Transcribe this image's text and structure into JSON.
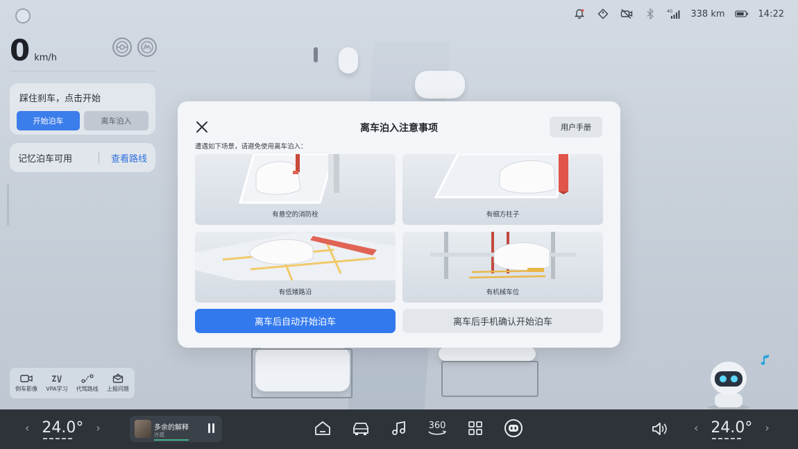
{
  "status_bar": {
    "range": "338 km",
    "time": "14:22",
    "icons": [
      "bell-icon",
      "tag-icon",
      "camera-off-icon",
      "bluetooth-icon",
      "signal-4g-icon",
      "battery-icon"
    ]
  },
  "left_panel": {
    "speed": "0",
    "speed_unit": "km/h",
    "assist_icons": [
      "apa-icon",
      "vpa-icon"
    ],
    "hint_text": "踩住刹车，点击开始",
    "start_parking_label": "开始泊车",
    "remote_parking_label": "离车泊入",
    "memory_parking_label": "记忆泊车可用",
    "view_route_label": "查看路线"
  },
  "tools": [
    {
      "label": "倒车影像",
      "icon": "camera-icon"
    },
    {
      "label": "VPA学习",
      "icon": "vpa-learn-icon"
    },
    {
      "label": "代驾路线",
      "icon": "route-icon"
    },
    {
      "label": "上报问题",
      "icon": "report-icon"
    }
  ],
  "modal": {
    "title": "离车泊入注意事项",
    "manual_label": "用户手册",
    "notice": "遭遇如下场景，请避免使用离车泊入：",
    "scenarios": [
      {
        "caption": "有悬空的消防栓"
      },
      {
        "caption": "有细方柱子"
      },
      {
        "caption": "有低矮路沿"
      },
      {
        "caption": "有机械车位"
      }
    ],
    "primary_action": "离车后自动开始泊车",
    "secondary_action": "离车后手机确认开始泊车"
  },
  "dock": {
    "left_temp": "24.0°",
    "right_temp": "24.0°",
    "song_title": "多余的解释",
    "song_artist": "许嵩",
    "icons": [
      "home-icon",
      "car-icon",
      "music-icon",
      "view-360-icon",
      "apps-icon",
      "assistant-icon"
    ],
    "view_360_label": "360"
  },
  "colors": {
    "accent": "#3379ee",
    "dock_bg": "#2e3339",
    "link": "#2f6fdc"
  }
}
